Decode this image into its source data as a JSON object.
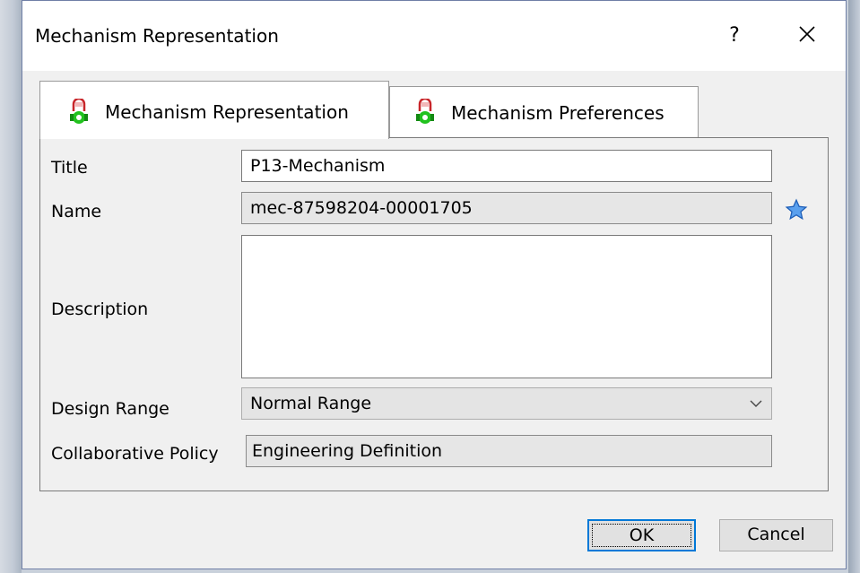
{
  "window": {
    "title": "Mechanism Representation",
    "help_label": "?",
    "close_icon": "close-icon"
  },
  "tabs": [
    {
      "label": "Mechanism Representation",
      "icon": "mechanism-icon",
      "active": true
    },
    {
      "label": "Mechanism Preferences",
      "icon": "mechanism-icon",
      "active": false
    }
  ],
  "form": {
    "title": {
      "label": "Title",
      "value": "P13-Mechanism"
    },
    "name": {
      "label": "Name",
      "value": "mec-87598204-00001705",
      "icon": "star-icon"
    },
    "description": {
      "label": "Description",
      "value": ""
    },
    "design_range": {
      "label": "Design Range",
      "value": "Normal Range"
    },
    "collaborative_policy": {
      "label": "Collaborative Policy",
      "value": "Engineering Definition"
    }
  },
  "buttons": {
    "ok": "OK",
    "cancel": "Cancel"
  },
  "colors": {
    "accent": "#0078d7",
    "star": "#2f7de1",
    "icon_green": "#22c21e",
    "icon_red": "#c8252a"
  }
}
